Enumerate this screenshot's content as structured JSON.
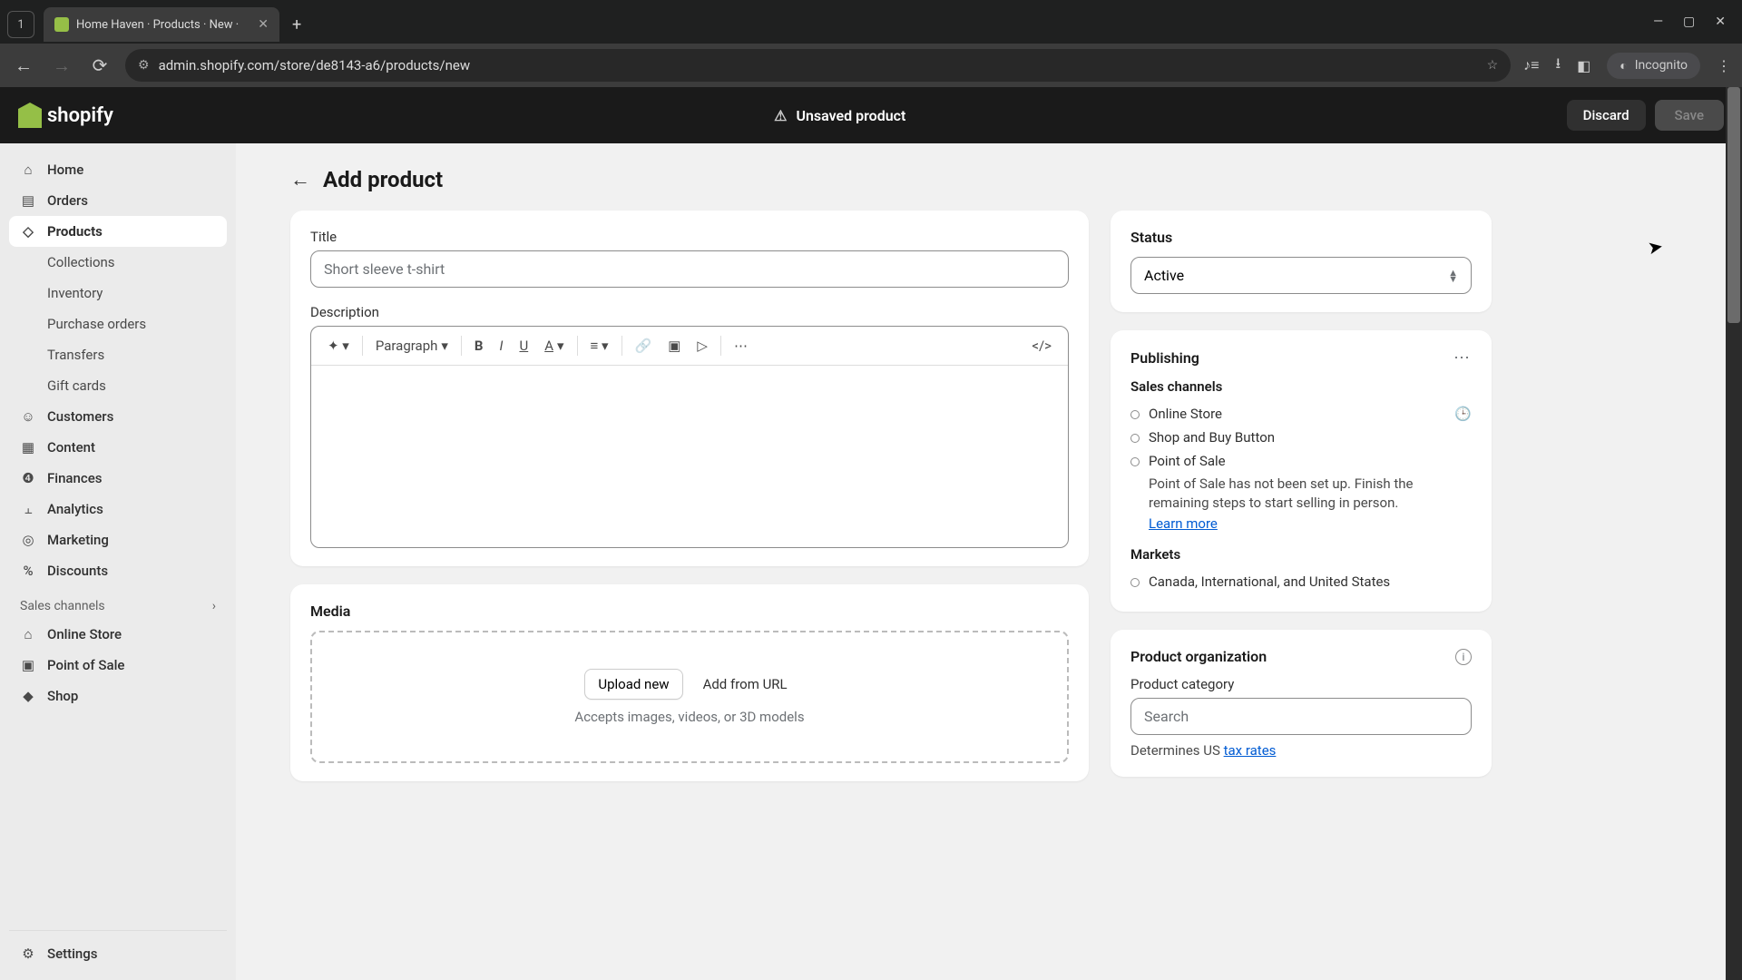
{
  "browser": {
    "tab_count": "1",
    "tab_title": "Home Haven · Products · New ·",
    "url": "admin.shopify.com/store/de8143-a6/products/new",
    "incognito": "Incognito"
  },
  "header": {
    "brand": "shopify",
    "unsaved": "Unsaved product",
    "discard": "Discard",
    "save": "Save"
  },
  "nav": {
    "home": "Home",
    "orders": "Orders",
    "products": "Products",
    "collections": "Collections",
    "inventory": "Inventory",
    "purchase_orders": "Purchase orders",
    "transfers": "Transfers",
    "gift_cards": "Gift cards",
    "customers": "Customers",
    "content": "Content",
    "finances": "Finances",
    "analytics": "Analytics",
    "marketing": "Marketing",
    "discounts": "Discounts",
    "section_channels": "Sales channels",
    "online_store": "Online Store",
    "pos": "Point of Sale",
    "shop": "Shop",
    "settings": "Settings"
  },
  "page": {
    "title": "Add product"
  },
  "product": {
    "title_label": "Title",
    "title_placeholder": "Short sleeve t-shirt",
    "description_label": "Description",
    "paragraph": "Paragraph",
    "media_heading": "Media",
    "upload_new": "Upload new",
    "add_from_url": "Add from URL",
    "media_hint": "Accepts images, videos, or 3D models"
  },
  "status": {
    "heading": "Status",
    "value": "Active"
  },
  "publishing": {
    "heading": "Publishing",
    "channels_heading": "Sales channels",
    "online_store": "Online Store",
    "shop_buy": "Shop and Buy Button",
    "pos": "Point of Sale",
    "pos_note": "Point of Sale has not been set up. Finish the remaining steps to start selling in person.",
    "learn_more": "Learn more",
    "markets_heading": "Markets",
    "markets_value": "Canada, International, and United States"
  },
  "organization": {
    "heading": "Product organization",
    "category_label": "Product category",
    "search_placeholder": "Search",
    "determines_prefix": "Determines US ",
    "tax_rates": "tax rates"
  }
}
